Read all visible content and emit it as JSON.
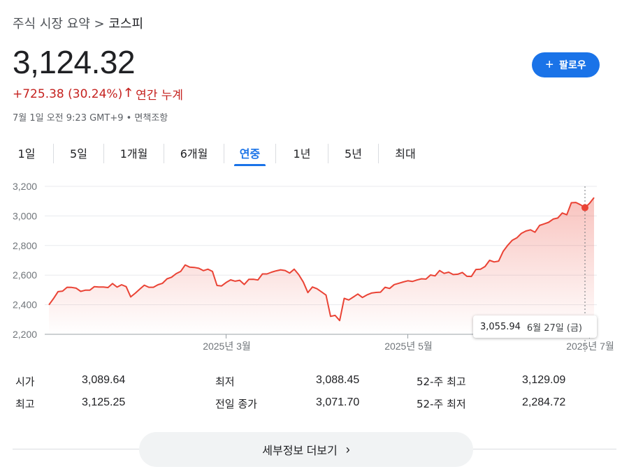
{
  "breadcrumb": {
    "parent": "주식 시장 요약",
    "separator": ">",
    "current": "코스피"
  },
  "quote": {
    "price": "3,124.32",
    "change": "+725.38 (30.24%)",
    "arrow": "🡑",
    "period": "연간 누계",
    "timestamp": "7월 1일 오전 9:23 GMT+9 • 면책조항"
  },
  "follow_button": {
    "icon": "plus-icon",
    "label": "팔로우"
  },
  "tabs": [
    {
      "label": "1일",
      "active": false
    },
    {
      "label": "5일",
      "active": false
    },
    {
      "label": "1개월",
      "active": false
    },
    {
      "label": "6개월",
      "active": false
    },
    {
      "label": "연중",
      "active": true
    },
    {
      "label": "1년",
      "active": false
    },
    {
      "label": "5년",
      "active": false
    },
    {
      "label": "최대",
      "active": false
    }
  ],
  "chart_data": {
    "type": "area",
    "y_ticks": [
      "3,200",
      "3,000",
      "2,800",
      "2,600",
      "2,400",
      "2,200"
    ],
    "y_tick_values": [
      3200,
      3000,
      2800,
      2600,
      2400,
      2200
    ],
    "ylim": [
      2200,
      3200
    ],
    "x_ticks": [
      "2025년 3월",
      "2025년 5월",
      "2025년 7월"
    ],
    "x_tick_positions": [
      39,
      79,
      119
    ],
    "x_range": [
      0,
      120
    ],
    "grid": true,
    "line_color": "#ea4335",
    "x": [
      0,
      1,
      2,
      3,
      4,
      5,
      6,
      7,
      8,
      9,
      10,
      11,
      12,
      13,
      14,
      15,
      16,
      17,
      18,
      19,
      20,
      21,
      22,
      23,
      24,
      25,
      26,
      27,
      28,
      29,
      30,
      31,
      32,
      33,
      34,
      35,
      36,
      37,
      38,
      39,
      40,
      41,
      42,
      43,
      44,
      45,
      46,
      47,
      48,
      49,
      50,
      51,
      52,
      53,
      54,
      55,
      56,
      57,
      58,
      59,
      60,
      61,
      62,
      63,
      64,
      65,
      66,
      67,
      68,
      69,
      70,
      71,
      72,
      73,
      74,
      75,
      76,
      77,
      78,
      79,
      80,
      81,
      82,
      83,
      84,
      85,
      86,
      87,
      88,
      89,
      90,
      91,
      92,
      93,
      94,
      95,
      96,
      97,
      98,
      99,
      100,
      101,
      102,
      103,
      104,
      105,
      106,
      107,
      108,
      109,
      110,
      111,
      112,
      113,
      114,
      115,
      116,
      117,
      118,
      119,
      120
    ],
    "series": [
      {
        "values": [
          2399,
          2441,
          2488,
          2492,
          2518,
          2517,
          2512,
          2490,
          2498,
          2498,
          2522,
          2520,
          2520,
          2516,
          2543,
          2519,
          2535,
          2522,
          2453,
          2478,
          2505,
          2532,
          2518,
          2518,
          2535,
          2545,
          2575,
          2586,
          2610,
          2625,
          2669,
          2654,
          2652,
          2646,
          2630,
          2640,
          2625,
          2530,
          2527,
          2550,
          2568,
          2559,
          2565,
          2537,
          2571,
          2572,
          2567,
          2608,
          2608,
          2620,
          2629,
          2636,
          2631,
          2614,
          2640,
          2603,
          2553,
          2482,
          2520,
          2508,
          2487,
          2465,
          2321,
          2328,
          2293,
          2443,
          2432,
          2452,
          2472,
          2449,
          2466,
          2479,
          2483,
          2485,
          2518,
          2510,
          2536,
          2545,
          2554,
          2562,
          2557,
          2567,
          2575,
          2573,
          2601,
          2595,
          2631,
          2612,
          2620,
          2604,
          2606,
          2618,
          2592,
          2591,
          2638,
          2640,
          2658,
          2700,
          2689,
          2695,
          2761,
          2802,
          2836,
          2852,
          2882,
          2898,
          2906,
          2890,
          2936,
          2946,
          2957,
          2979,
          2986,
          3020,
          3008,
          3089,
          3091,
          3076,
          3056,
          3085,
          3124
        ]
      }
    ],
    "highlight": {
      "index": 118,
      "value": "3,055.94",
      "date": "6월 27일 (금)"
    }
  },
  "stats": [
    {
      "label": "시가",
      "value": "3,089.64"
    },
    {
      "label": "최저",
      "value": "3,088.45"
    },
    {
      "label": "52-주 최고",
      "value": "3,129.09"
    },
    {
      "label": "최고",
      "value": "3,125.25"
    },
    {
      "label": "전일 종가",
      "value": "3,071.70"
    },
    {
      "label": "52-주 최저",
      "value": "2,284.72"
    }
  ],
  "more_button": {
    "label": "세부정보 더보기",
    "icon": "chevron-right-icon"
  }
}
